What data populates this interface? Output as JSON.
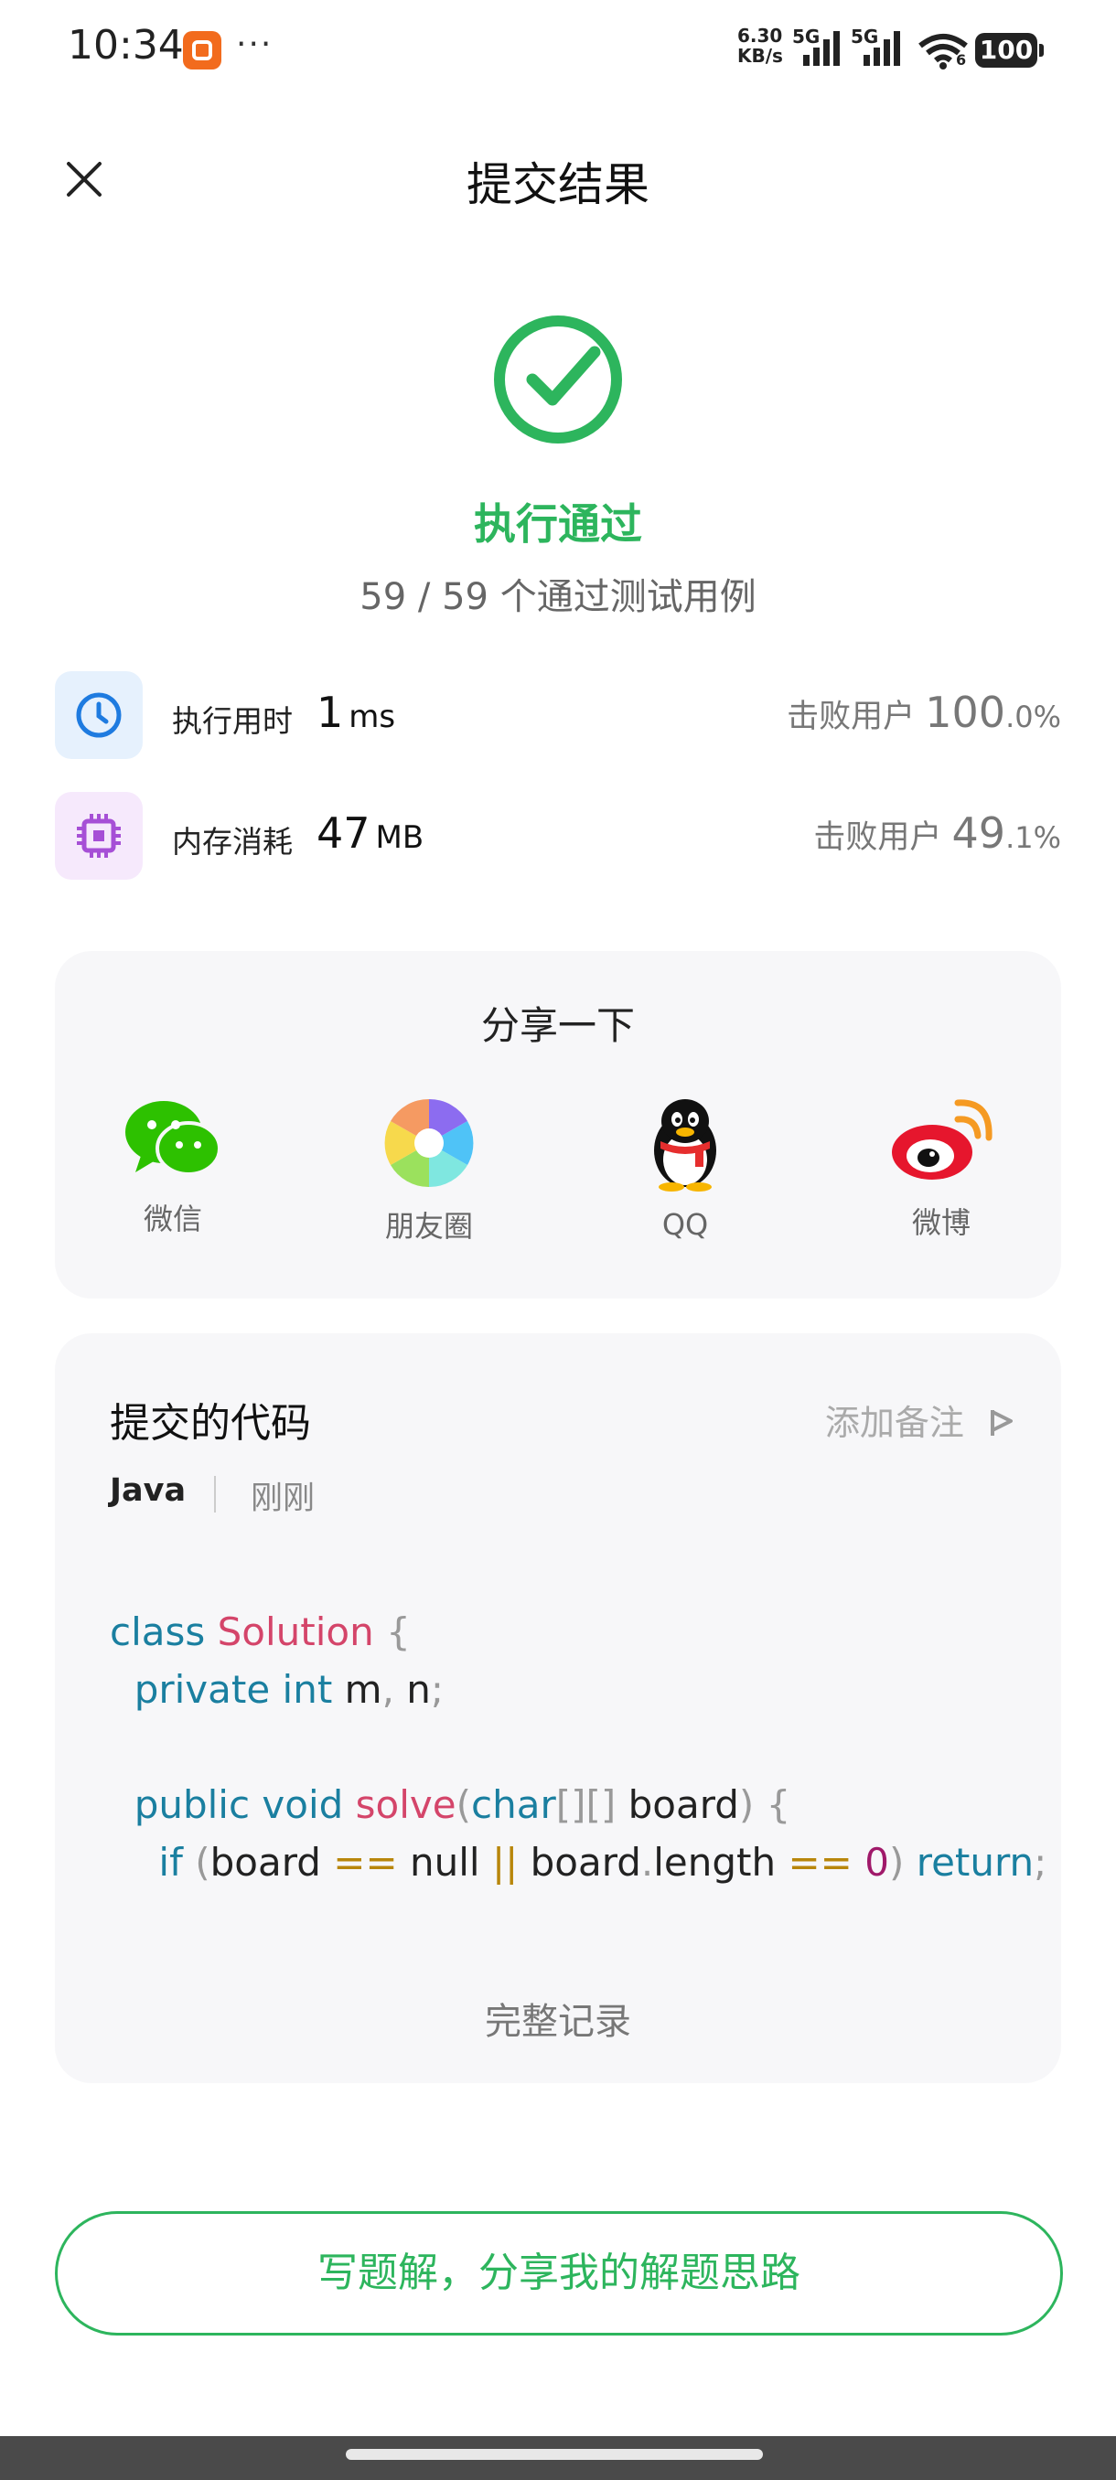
{
  "status_bar": {
    "time": "10:34",
    "more": "···",
    "net_speed_value": "6.30",
    "net_speed_unit": "KB/s",
    "sim1": "5G",
    "sim2": "5G",
    "wifi_tag": "6",
    "battery": "100"
  },
  "header": {
    "title": "提交结果"
  },
  "result": {
    "title": "执行通过",
    "subtitle": "59 / 59 个通过测试用例",
    "accent_color": "#2db55d"
  },
  "metrics": [
    {
      "label": "执行用时",
      "value": "1",
      "unit": "ms",
      "beat_prefix": "击败用户",
      "beat_int": "100",
      "beat_dec": ".0%"
    },
    {
      "label": "内存消耗",
      "value": "47",
      "unit": "MB",
      "beat_prefix": "击败用户",
      "beat_int": "49",
      "beat_dec": ".1%"
    }
  ],
  "share": {
    "title": "分享一下",
    "items": [
      {
        "label": "微信",
        "icon": "wechat-icon"
      },
      {
        "label": "朋友圈",
        "icon": "moments-icon"
      },
      {
        "label": "QQ",
        "icon": "qq-icon"
      },
      {
        "label": "微博",
        "icon": "weibo-icon"
      }
    ]
  },
  "code": {
    "title": "提交的代码",
    "note_link": "添加备注",
    "language": "Java",
    "time": "刚刚",
    "full_record": "完整记录"
  },
  "footer": {
    "solution_button": "写题解，分享我的解题思路"
  }
}
